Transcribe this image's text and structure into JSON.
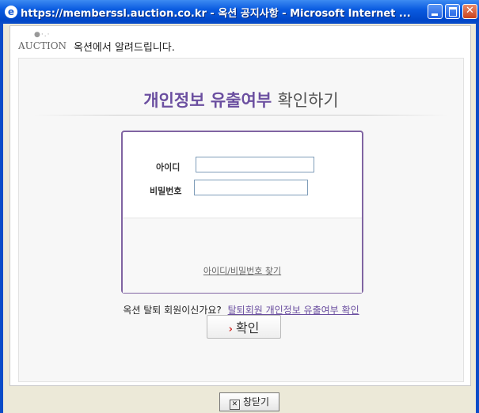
{
  "window": {
    "title": "https://memberssl.auction.co.kr - 옥션 공지사항 - Microsoft Internet ...",
    "close_glyph": "✕"
  },
  "header": {
    "logo_text": "AUCTION",
    "notice_text": "옥션에서 알려드립니다."
  },
  "main": {
    "heading_em": "개인정보 유출여부",
    "heading_rest": "확인하기"
  },
  "login": {
    "id_label": "아이디",
    "id_value": "",
    "password_label": "비밀번호",
    "password_value": "",
    "confirm_label": "확인",
    "find_link": "아이디/비밀번호 찾기"
  },
  "withdrawn": {
    "question": "옥션 탈퇴 회원이신가요?",
    "link": "탈퇴회원 개인정보 유출여부 확인"
  },
  "footer": {
    "close_label": "창닫기"
  },
  "colors": {
    "accent": "#6b4fa0",
    "titlebar": "#0a4cc8"
  }
}
